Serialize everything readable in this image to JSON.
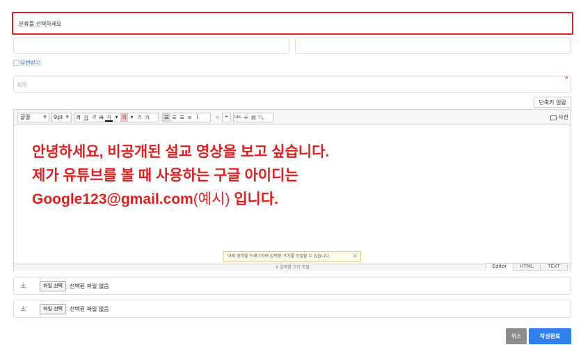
{
  "form": {
    "category_placeholder": "분류를 선택하세요",
    "notify_label": "답변받기",
    "subject_placeholder": "제목",
    "required_mark": "*",
    "shortcut_button": "단축키 일람"
  },
  "editor": {
    "toolbar": {
      "font_select": "글꼴",
      "size_select": "9pt",
      "bold": "가",
      "underline": "가",
      "italic": "가",
      "strike": "가",
      "font_color": "가",
      "bg_color": "가",
      "superscript": "가",
      "subscript": "가",
      "align_justify": "≡",
      "quote": "❝",
      "url": "URL",
      "photo": "사진"
    },
    "content": {
      "line1": "안녕하세요, 비공개된 설교 영상을 보고 싶습니다.",
      "line2": "제가 유튜브를 볼 때 사용하는 구글 아이디는",
      "line3_email": "Google123@gmail.com",
      "line3_paren": "(예시)",
      "line3_end": " 입니다."
    },
    "resize_tip": "아래 영역을 드래그하여 입력창 크기를 조절할 수 있습니다.",
    "resize_bar": "⇕ 입력창 크기 조절",
    "modes": [
      "Editor",
      "HTML",
      "TEXT"
    ]
  },
  "files": [
    {
      "choose_label": "파일 선택",
      "status": "선택된 파일 없음"
    },
    {
      "choose_label": "파일 선택",
      "status": "선택된 파일 없음"
    }
  ],
  "actions": {
    "cancel": "취소",
    "submit": "작성완료"
  },
  "colors": {
    "accent": "#2f80ed",
    "error": "#e02020",
    "cancel": "#8c8c8c"
  }
}
